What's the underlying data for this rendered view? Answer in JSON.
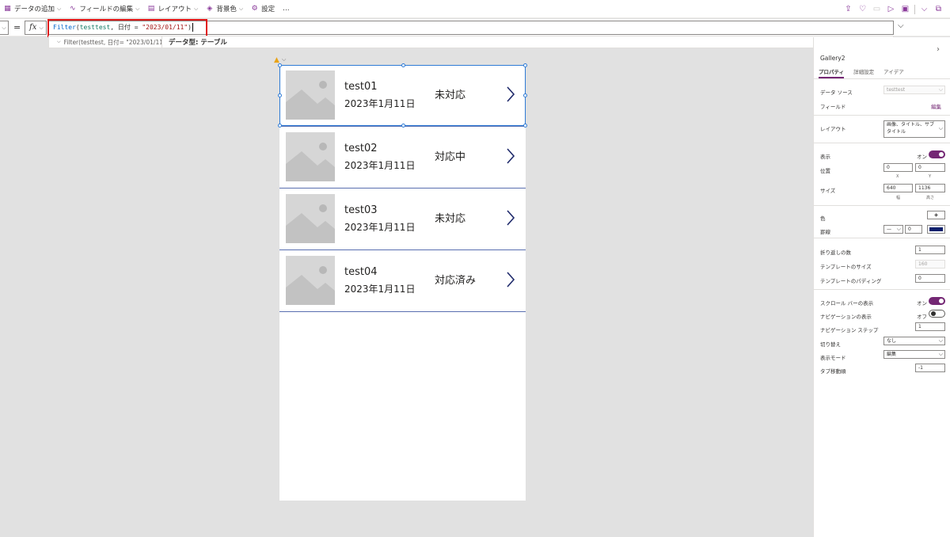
{
  "toolbar": {
    "add_data": "データの追加",
    "edit_fields": "フィールドの編集",
    "layout": "レイアウト",
    "background": "背景色",
    "settings": "設定",
    "more": "…"
  },
  "formula": {
    "equals": "=",
    "fx": "fx",
    "fn": "Filter",
    "open": "(",
    "source": "testtest",
    "middle": ", 日付 = ",
    "value": "\"2023/01/11\"",
    "close": ")",
    "result_expr": "Filter(testtest, 日付= \"2023/01/11\")",
    "data_type": "データ型: テーブル"
  },
  "gallery": {
    "items": [
      {
        "title": "test01",
        "date": "2023年1月11日",
        "status": "未対応"
      },
      {
        "title": "test02",
        "date": "2023年1月11日",
        "status": "対応中"
      },
      {
        "title": "test03",
        "date": "2023年1月11日",
        "status": "未対応"
      },
      {
        "title": "test04",
        "date": "2023年1月11日",
        "status": "対応済み"
      }
    ]
  },
  "panel": {
    "control_name": "Gallery2",
    "tabs": [
      "プロパティ",
      "詳細設定",
      "アイデア"
    ],
    "data_source_label": "データ ソース",
    "data_source_value": "testtest",
    "fields_label": "フィールド",
    "fields_edit": "編集",
    "layout_label": "レイアウト",
    "layout_value": "画像、タイトル、サブタイトル",
    "visible_label": "表示",
    "visible_state": "オン",
    "position_label": "位置",
    "position_x": "0",
    "position_y": "0",
    "x_label": "X",
    "y_label": "Y",
    "size_label": "サイズ",
    "width": "640",
    "height": "1136",
    "width_label": "幅",
    "height_label": "高さ",
    "color_label": "色",
    "border_label": "罫線",
    "border_width": "0",
    "wrap_label": "折り返しの数",
    "wrap_value": "1",
    "template_size_label": "テンプレートのサイズ",
    "template_size_value": "160",
    "template_padding_label": "テンプレートのパディング",
    "template_padding_value": "0",
    "scrollbar_label": "スクロール バーの表示",
    "scrollbar_state": "オン",
    "nav_label": "ナビゲーションの表示",
    "nav_state": "オフ",
    "nav_step_label": "ナビゲーション ステップ",
    "nav_step_value": "1",
    "wrap2_label": "切り替え",
    "wrap2_value": "なし",
    "display_mode_label": "表示モード",
    "display_mode_value": "編集",
    "tab_index_label": "タブ移動順",
    "tab_index_value": "-1"
  },
  "colors": {
    "accent": "#742774",
    "selection": "#2e7bd6",
    "highlight": "#e01818",
    "border_color_swatch": "#0b1f6b",
    "divider": "#5a6fb0"
  }
}
